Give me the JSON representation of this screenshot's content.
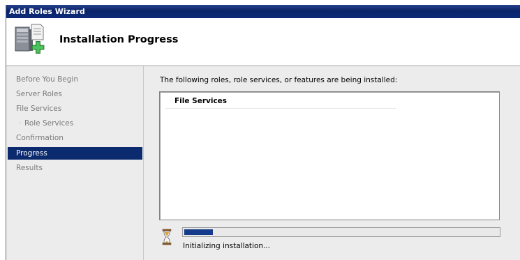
{
  "window": {
    "title": "Add Roles Wizard"
  },
  "header": {
    "title": "Installation Progress",
    "icon": "server-add-icon"
  },
  "sidebar": {
    "items": [
      {
        "label": "Before You Begin",
        "sub": false,
        "active": false
      },
      {
        "label": "Server Roles",
        "sub": false,
        "active": false
      },
      {
        "label": "File Services",
        "sub": false,
        "active": false
      },
      {
        "label": "Role Services",
        "sub": true,
        "active": false
      },
      {
        "label": "Confirmation",
        "sub": false,
        "active": false
      },
      {
        "label": "Progress",
        "sub": false,
        "active": true
      },
      {
        "label": "Results",
        "sub": false,
        "active": false
      }
    ]
  },
  "main": {
    "intro": "The following roles, role services, or features are being installed:",
    "list": {
      "heading": "File Services"
    },
    "progress": {
      "fraction": 0.09,
      "status": "Initializing installation...",
      "icon": "hourglass-icon"
    }
  },
  "colors": {
    "title_bar": "#0a246a",
    "active_nav": "#0c2b6e",
    "progress_fill": "#153b8a"
  }
}
